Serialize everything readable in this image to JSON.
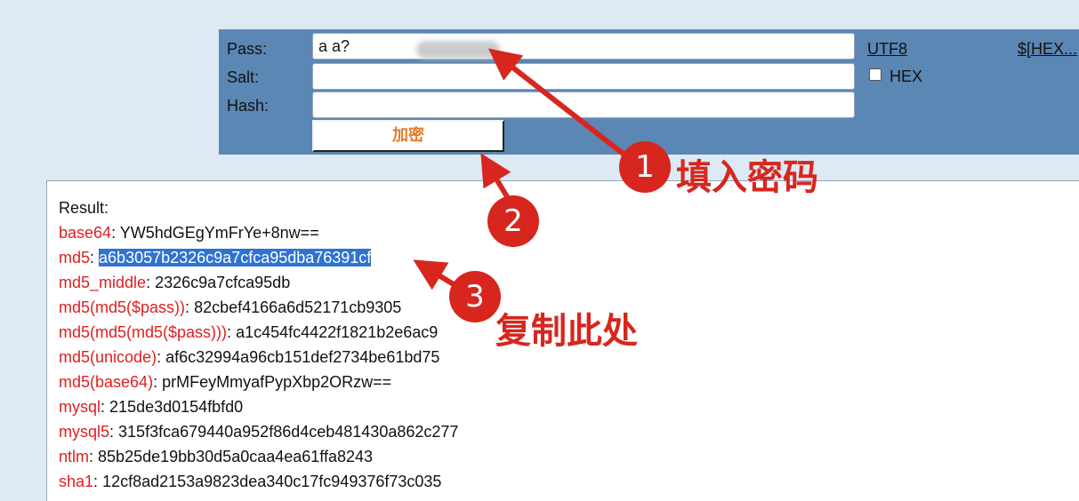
{
  "form": {
    "pass_label": "Pass:",
    "pass_value": "a            a?",
    "salt_label": "Salt:",
    "salt_value": "",
    "hash_label": "Hash:",
    "hash_value": "",
    "encrypt_button": "加密",
    "utf8_link": "UTF8",
    "hex_link": "$[HEX...",
    "hex_checkbox_label": "HEX",
    "hex_checked": false
  },
  "result": {
    "heading": "Result:",
    "rows": [
      {
        "key": "base64",
        "sep": ": ",
        "value": "YW5hdGEgYmFrYe+8nw=="
      },
      {
        "key": "md5",
        "sep": ": ",
        "value": "a6b3057b2326c9a7cfca95dba76391cf",
        "selected": true
      },
      {
        "key": "md5_middle",
        "sep": ": ",
        "value": "2326c9a7cfca95db"
      },
      {
        "key": "md5(md5($pass))",
        "sep": ": ",
        "value": "82cbef4166a6d52171cb9305"
      },
      {
        "key": "md5(md5(md5($pass)))",
        "sep": ": ",
        "value": "a1c454fc4422f1821b2e6ac9"
      },
      {
        "key": "md5(unicode)",
        "sep": ": ",
        "value": "af6c32994a96cb151def2734be61bd75"
      },
      {
        "key": "md5(base64)",
        "sep": ": ",
        "value": "prMFeyMmyafPypXbp2ORzw=="
      },
      {
        "key": "mysql",
        "sep": ": ",
        "value": "215de3d0154fbfd0"
      },
      {
        "key": "mysql5",
        "sep": ": ",
        "value": "315f3fca679440a952f86d4ceb481430a862c277"
      },
      {
        "key": "ntlm",
        "sep": ": ",
        "value": "85b25de19bb30d5a0caa4ea61ffa8243"
      },
      {
        "key": "sha1",
        "sep": ": ",
        "value": "12cf8ad2153a9823dea340c17fc949376f73c035"
      }
    ]
  },
  "annotations": {
    "step1_number": "1",
    "step1_text": "填入密码",
    "step2_number": "2",
    "step3_number": "3",
    "step3_text": "复制此处",
    "color": "#d7261e"
  }
}
